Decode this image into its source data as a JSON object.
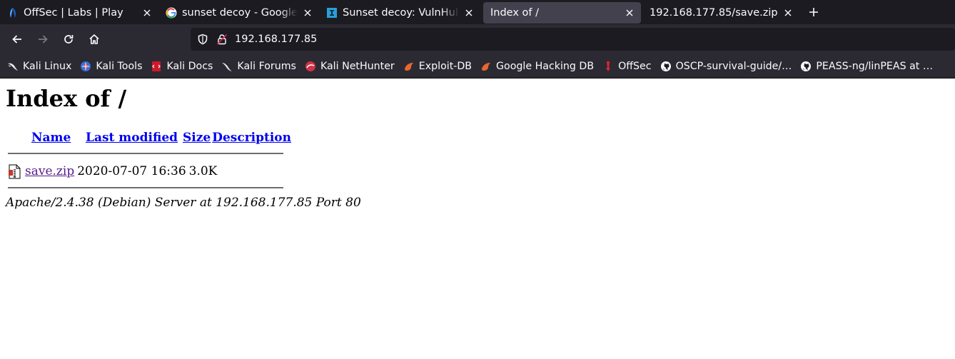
{
  "browser": {
    "tabs": [
      {
        "title": "OffSec | Labs | Play",
        "icon": "offsec-icon",
        "active": false
      },
      {
        "title": "sunset decoy - Google Se",
        "icon": "google-icon",
        "active": false
      },
      {
        "title": "Sunset decoy: VulnHub C",
        "icon": "infosec-icon",
        "active": false
      },
      {
        "title": "Index of /",
        "icon": "",
        "active": true
      },
      {
        "title": "192.168.177.85/save.zip",
        "icon": "",
        "active": false
      }
    ],
    "url": "192.168.177.85",
    "bookmarks": [
      {
        "label": "Kali Linux",
        "icon": "kali-icon"
      },
      {
        "label": "Kali Tools",
        "icon": "kali-tools-icon"
      },
      {
        "label": "Kali Docs",
        "icon": "kali-docs-icon"
      },
      {
        "label": "Kali Forums",
        "icon": "kali-forums-icon"
      },
      {
        "label": "Kali NetHunter",
        "icon": "nethunter-icon"
      },
      {
        "label": "Exploit-DB",
        "icon": "exploit-db-icon"
      },
      {
        "label": "Google Hacking DB",
        "icon": "ghdb-icon"
      },
      {
        "label": "OffSec",
        "icon": "offsec-bookmark-icon"
      },
      {
        "label": "OSCP-survival-guide/…",
        "icon": "github-icon"
      },
      {
        "label": "PEASS-ng/linPEAS at …",
        "icon": "github-icon"
      }
    ]
  },
  "page": {
    "heading": "Index of /",
    "columns": {
      "name": "Name",
      "last_modified": "Last modified",
      "size": "Size",
      "description": "Description"
    },
    "files": [
      {
        "name": "save.zip",
        "modified": "2020-07-07 16:36",
        "size": "3.0K",
        "description": "",
        "icon": "compressed-file-icon"
      }
    ],
    "server_signature": "Apache/2.4.38 (Debian) Server at 192.168.177.85 Port 80"
  }
}
